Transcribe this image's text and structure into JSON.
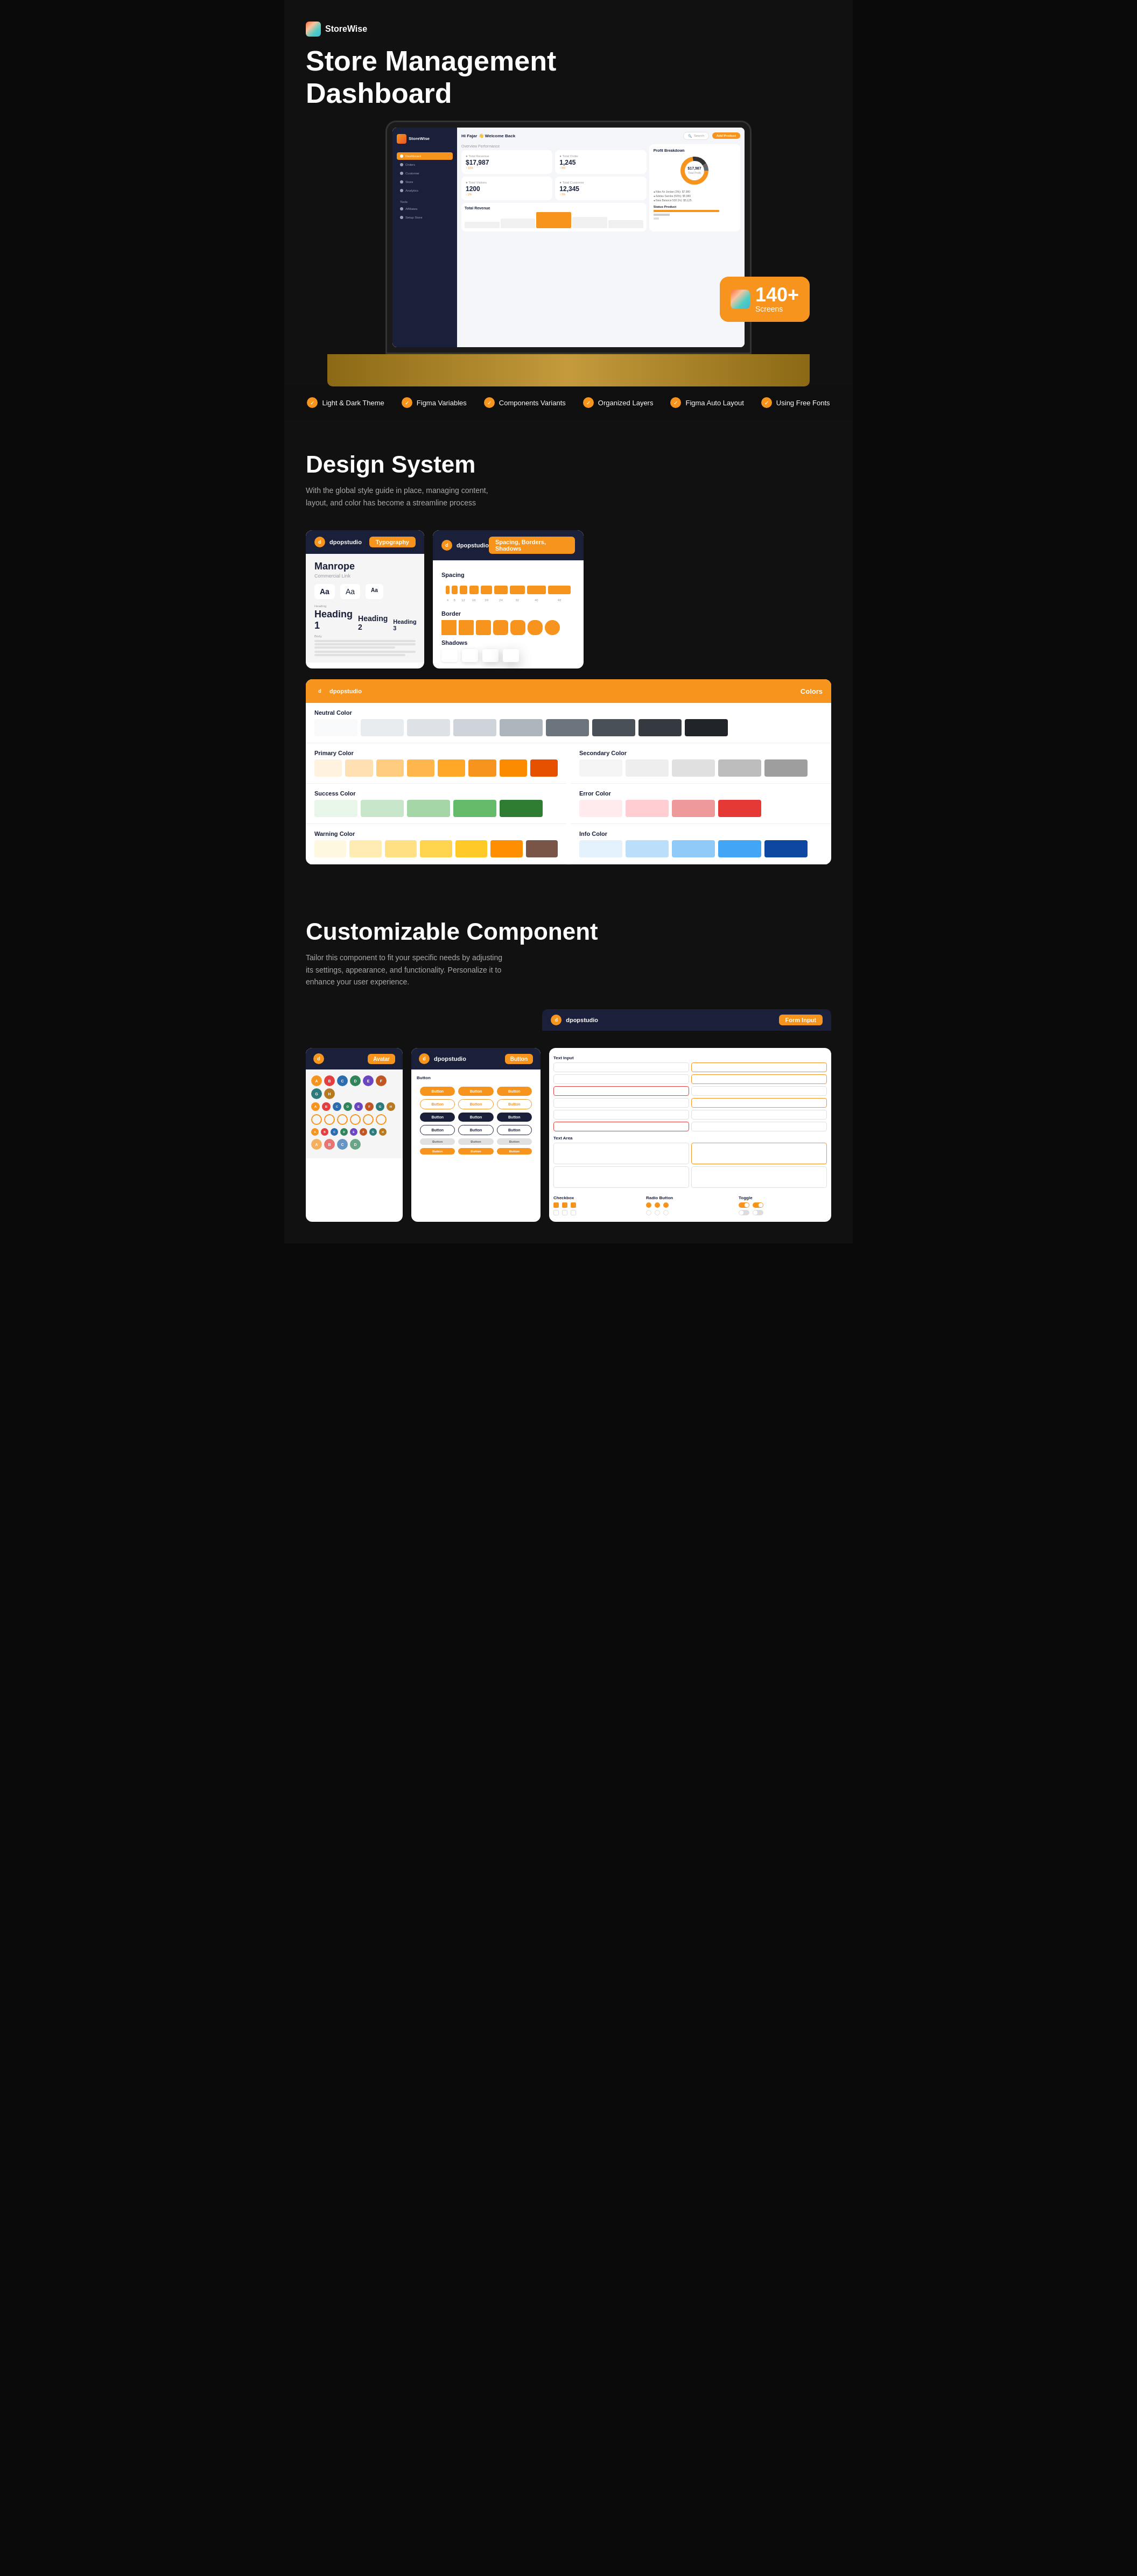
{
  "hero": {
    "logo": {
      "text": "StoreWise"
    },
    "title_line1": "Store Management",
    "title_line2": "Dashboard",
    "badge": {
      "number": "140+",
      "label": "Screens"
    },
    "add_product_btn": "Add Product"
  },
  "features": [
    {
      "id": "light-dark",
      "label": "Light & Dark Theme",
      "icon": "✓"
    },
    {
      "id": "figma-vars",
      "label": "Figma Variables",
      "icon": "✓"
    },
    {
      "id": "comp-variants",
      "label": "Components Variants",
      "icon": "✓"
    },
    {
      "id": "org-layers",
      "label": "Organized Layers",
      "icon": "✓"
    },
    {
      "id": "auto-layout",
      "label": "Figma Auto Layout",
      "icon": "✓"
    },
    {
      "id": "free-fonts",
      "label": "Using Free Fonts",
      "icon": "✓"
    }
  ],
  "design_system": {
    "title": "Design System",
    "subtitle": "With the global style guide in place, managing content, layout, and color has become a streamline process",
    "brand": "dpopstudio",
    "typography_tab": "Typography",
    "spacing_tab": "Spacing, Borders, Shadows",
    "colors_tab": "Colors",
    "font_name": "Manrope",
    "font_sub": "Commercial Link",
    "spacing_title": "Spacing",
    "border_title": "Border",
    "shadows_title": "Shadows",
    "neutral_color": "Neutral Color",
    "primary_color": "Primary Color",
    "secondary_color": "Secondary Color",
    "success_color": "Success Color",
    "error_color": "Error Color",
    "warning_color": "Warning Color",
    "info_color": "Info Color"
  },
  "customizable": {
    "title": "Customizable Component",
    "subtitle": "Tailor this component to fit your specific needs by adjusting its settings, appearance, and functionality. Personalize it to enhance your user experience.",
    "brand": "dpopstudio",
    "avatar_tab": "Avatar",
    "button_tab": "Button",
    "form_tab": "Form Input",
    "text_input_label": "Text Input",
    "text_area_label": "Text Area",
    "checkbox_label": "Checkbox",
    "radio_label": "Radio Button",
    "toggle_label": "Toggle"
  },
  "dashboard": {
    "greeting": "Hi Fajar 👋 Welcome Back",
    "search_placeholder": "Search",
    "add_product": "Add Product",
    "customer_label": "Customer",
    "total_revenue": "$17,987",
    "total_orders": "1,245",
    "total_visitors": "1200",
    "total_customers": "12,345",
    "profit": "$17,987",
    "sidebar_items": [
      "Dashboard",
      "Orders",
      "Customer",
      "Store",
      "Analytics",
      "Affiliates",
      "Setup Store"
    ]
  },
  "colors": {
    "neutral": [
      "#f8f9fa",
      "#e9ecef",
      "#dee2e6",
      "#ced4da",
      "#adb5bd",
      "#6c757d",
      "#495057",
      "#343a40",
      "#212529"
    ],
    "primary": [
      "#fff3e0",
      "#ffe0b2",
      "#ffcc80",
      "#ffb74d",
      "#ffa726",
      "#f7941d",
      "#fb8c00",
      "#e65100"
    ],
    "secondary": [
      "#f5f5f5",
      "#eeeeee",
      "#e0e0e0",
      "#bdbdbd",
      "#9e9e9e"
    ],
    "success": [
      "#e8f5e9",
      "#c8e6c9",
      "#a5d6a7",
      "#66bb6a",
      "#2e7d32"
    ],
    "error": [
      "#ffebee",
      "#ffcdd2",
      "#ef9a9a",
      "#e53935"
    ],
    "warning": [
      "#fff8e1",
      "#ffecb3",
      "#ffe082",
      "#ffd54f",
      "#ffca28",
      "#ff8f00",
      "#795548"
    ],
    "info": [
      "#e3f2fd",
      "#bbdefb",
      "#90caf9",
      "#42a5f5",
      "#0d47a1"
    ]
  },
  "avatars": {
    "colors": [
      "#f7941d",
      "#e53e3e",
      "#2b6cb0",
      "#2f855a",
      "#6b46c1",
      "#c05621",
      "#2c7a7b",
      "#b7791f"
    ]
  }
}
